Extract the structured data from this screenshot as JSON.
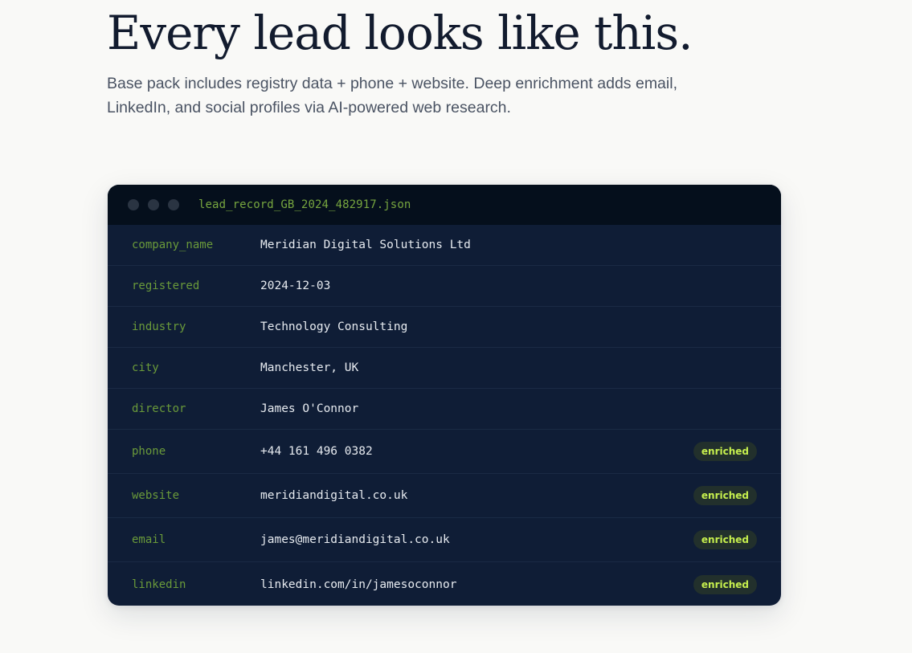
{
  "headline": "Every lead looks like this.",
  "subtitle": "Base pack includes registry data + phone + website. Deep enrichment adds email, LinkedIn, and social profiles via AI-powered web research.",
  "card": {
    "filename": "lead_record_GB_2024_482917.json",
    "rows": [
      {
        "key": "company_name",
        "value": "Meridian Digital Solutions Ltd",
        "badge": ""
      },
      {
        "key": "registered",
        "value": "2024-12-03",
        "badge": ""
      },
      {
        "key": "industry",
        "value": "Technology Consulting",
        "badge": ""
      },
      {
        "key": "city",
        "value": "Manchester, UK",
        "badge": ""
      },
      {
        "key": "director",
        "value": "James O'Connor",
        "badge": ""
      },
      {
        "key": "phone",
        "value": "+44 161 496 0382",
        "badge": "enriched"
      },
      {
        "key": "website",
        "value": "meridiandigital.co.uk",
        "badge": "enriched"
      },
      {
        "key": "email",
        "value": "james@meridiandigital.co.uk",
        "badge": "enriched"
      },
      {
        "key": "linkedin",
        "value": "linkedin.com/in/jamesoconnor",
        "badge": "enriched"
      }
    ]
  },
  "colors": {
    "page_background": "#f9f9f7",
    "card_background": "#0f1d36",
    "card_header": "#050f1c",
    "key_text": "#6a9a3a",
    "badge_text": "#c6ef4e"
  }
}
